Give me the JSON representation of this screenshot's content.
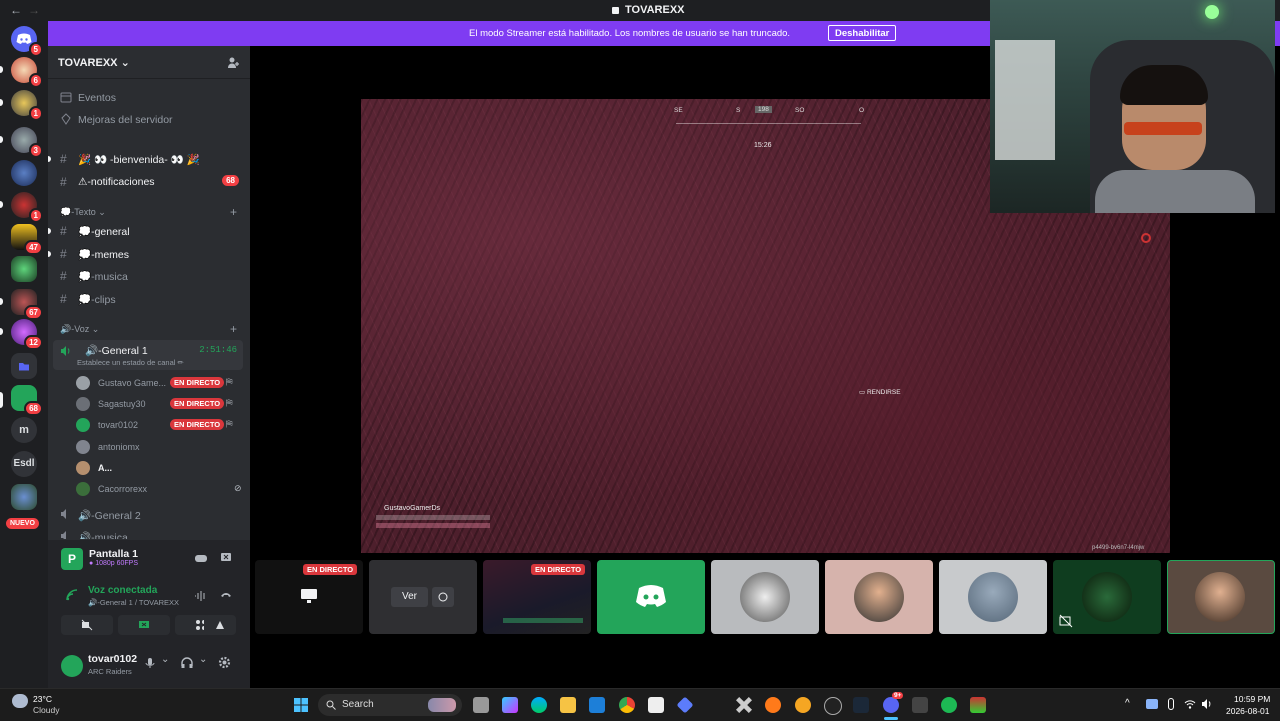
{
  "window": {
    "title": "TOVAREXX",
    "back": "←",
    "forward": "→"
  },
  "banner": {
    "text": "El modo Streamer está habilitado. Los nombres de usuario se han truncado.",
    "button": "Deshabilitar"
  },
  "servers": {
    "badges": [
      "5",
      "6",
      "1",
      "3",
      "1",
      "47",
      "67",
      "12",
      "68",
      "4"
    ],
    "letters": {
      "m": "m",
      "esdl": "Esdl"
    },
    "new_label": "NUEVO"
  },
  "guild": {
    "name": "TOVAREXX",
    "chevron": "⌄",
    "events": "Eventos",
    "boosts": "Mejoras del servidor"
  },
  "channels": {
    "welcome": "🎉 👀 -bienvenida- 👀 🎉",
    "notifications": "⚠-notificaciones",
    "notifications_badge": "68",
    "text_category": "💭-Texto",
    "general": "💭-general",
    "memes": "💭-memes",
    "musica": "💭-musica",
    "clips": "💭-clips",
    "voice_category": "🔊-Voz",
    "general1": "🔊-General 1",
    "general1_time": "2:51:46",
    "general1_status": "Establece un estado de canal ✏",
    "general2": "🔊-General 2",
    "musica_voice": "🔊-musica"
  },
  "voice_users": [
    {
      "name": "Gustavo Game...",
      "live": "EN DIRECTO",
      "color": "#9aa0a6"
    },
    {
      "name": "Sagastuy30",
      "live": "EN DIRECTO",
      "color": "#6b6f76"
    },
    {
      "name": "tovar0102",
      "live": "EN DIRECTO",
      "color": "#23a55a"
    },
    {
      "name": "antoniomx",
      "live": "",
      "color": "#80848e"
    },
    {
      "name": "A...",
      "live": "",
      "color": "#b58f6e"
    },
    {
      "name": "Cacorrorexx",
      "live": "",
      "color": "#3b6e3b"
    }
  ],
  "panel": {
    "stream_title": "Pantalla 1",
    "stream_quality": "1080p 60FPS",
    "voice_status": "Voz conectada",
    "voice_channel": "🔊-General 1 / TOVAREXX",
    "user_name": "tovar0102",
    "user_activity": "ARC Raiders"
  },
  "game": {
    "compass": [
      "SE",
      "S",
      "198",
      "SO",
      "O"
    ],
    "timer": "15:26",
    "surrender": "RENDIRSE",
    "player_tag": "GustavoGamerDs",
    "stream_id": "p4499-bv6n7-l4mjw"
  },
  "tiles": {
    "live1": "EN DIRECTO",
    "watch": "Ver",
    "live2": "EN DIRECTO"
  },
  "taskbar": {
    "weather_temp": "23°C",
    "weather_desc": "Cloudy",
    "search": "Search",
    "time": "10:59 PM",
    "date": "2026-08-01",
    "discord_badge": "9+"
  },
  "colors": {
    "accent": "#5865f2",
    "live": "#da373c",
    "online": "#23a55a",
    "banner": "#7f3cf2"
  }
}
